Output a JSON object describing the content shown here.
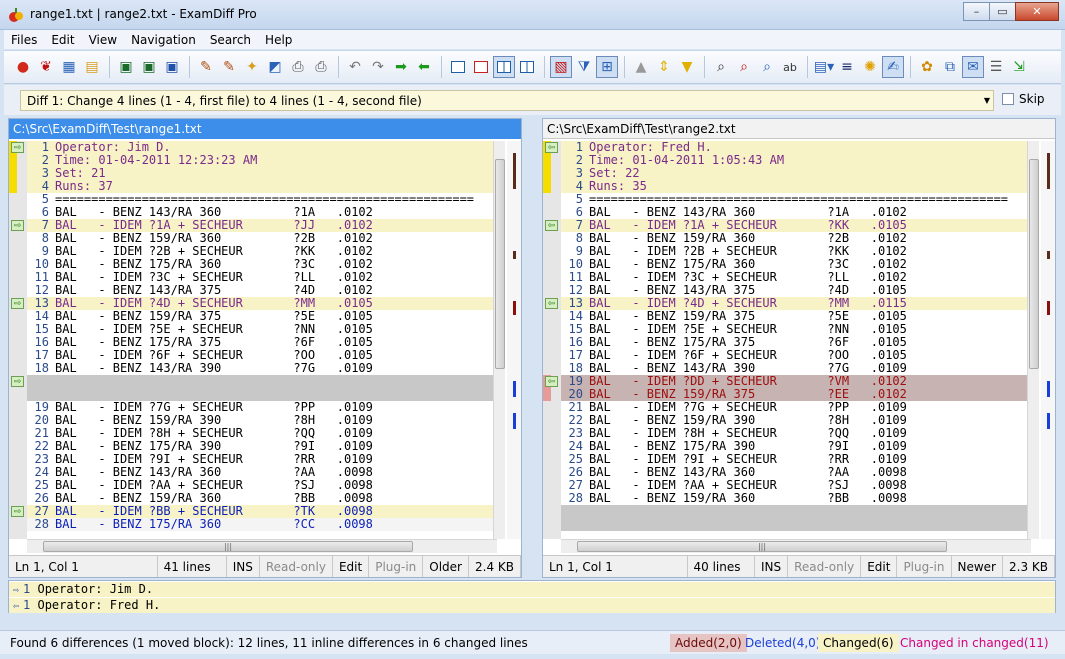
{
  "window": {
    "title": "range1.txt  |  range2.txt - ExamDiff Pro"
  },
  "menu": [
    "Files",
    "Edit",
    "View",
    "Navigation",
    "Search",
    "Help"
  ],
  "diff_selector": {
    "value": "Diff 1: Change 4 lines (1 - 4, first file) to 4 lines (1 - 4, second file)",
    "skip_label": "Skip"
  },
  "left": {
    "path": "C:\\Src\\ExamDiff\\Test\\range1.txt",
    "lines": [
      {
        "n": "1",
        "t": "Operator: Jim D.",
        "k": "chg"
      },
      {
        "n": "2",
        "t": "Time: 01-04-2011 12:23:23 AM",
        "k": "chg"
      },
      {
        "n": "3",
        "t": "Set: 21",
        "k": "chg"
      },
      {
        "n": "4",
        "t": "Runs: 37",
        "k": "chg"
      },
      {
        "n": "5",
        "t": "==========================================================",
        "k": ""
      },
      {
        "n": "6",
        "t": "BAL   - BENZ 143/RA 360          ?1A   .0102",
        "k": ""
      },
      {
        "n": "7",
        "t": "BAL   - IDEM ?1A + SECHEUR       ?JJ   .0102",
        "k": "chg"
      },
      {
        "n": "8",
        "t": "BAL   - BENZ 159/RA 360          ?2B   .0102",
        "k": ""
      },
      {
        "n": "9",
        "t": "BAL   - IDEM ?2B + SECHEUR       ?KK   .0102",
        "k": ""
      },
      {
        "n": "10",
        "t": "BAL   - BENZ 175/RA 360          ?3C   .0102",
        "k": ""
      },
      {
        "n": "11",
        "t": "BAL   - IDEM ?3C + SECHEUR       ?LL   .0102",
        "k": ""
      },
      {
        "n": "12",
        "t": "BAL   - BENZ 143/RA 375          ?4D   .0102",
        "k": ""
      },
      {
        "n": "13",
        "t": "BAL   - IDEM ?4D + SECHEUR       ?MM   .0105",
        "k": "chg"
      },
      {
        "n": "14",
        "t": "BAL   - BENZ 159/RA 375          ?5E   .0105",
        "k": ""
      },
      {
        "n": "15",
        "t": "BAL   - IDEM ?5E + SECHEUR       ?NN   .0105",
        "k": ""
      },
      {
        "n": "16",
        "t": "BAL   - BENZ 175/RA 375          ?6F   .0105",
        "k": ""
      },
      {
        "n": "17",
        "t": "BAL   - IDEM ?6F + SECHEUR       ?OO   .0105",
        "k": ""
      },
      {
        "n": "18",
        "t": "BAL   - BENZ 143/RA 390          ?7G   .0109",
        "k": ""
      },
      {
        "n": "19",
        "t": "BAL   - IDEM ?7G + SECHEUR       ?PP   .0109",
        "k": ""
      },
      {
        "n": "20",
        "t": "BAL   - BENZ 159/RA 390          ?8H   .0109",
        "k": ""
      },
      {
        "n": "21",
        "t": "BAL   - IDEM ?8H + SECHEUR       ?QQ   .0109",
        "k": ""
      },
      {
        "n": "22",
        "t": "BAL   - BENZ 175/RA 390          ?9I   .0109",
        "k": ""
      },
      {
        "n": "23",
        "t": "BAL   - IDEM ?9I + SECHEUR       ?RR   .0109",
        "k": ""
      },
      {
        "n": "24",
        "t": "BAL   - BENZ 143/RA 360          ?AA   .0098",
        "k": ""
      },
      {
        "n": "25",
        "t": "BAL   - IDEM ?AA + SECHEUR       ?SJ   .0098",
        "k": ""
      },
      {
        "n": "26",
        "t": "BAL   - BENZ 159/RA 360          ?BB   .0098",
        "k": ""
      },
      {
        "n": "27",
        "t": "BAL   - IDEM ?BB + SECHEUR       ?TK   .0098",
        "k": "mov"
      },
      {
        "n": "28",
        "t": "BAL   - BENZ 175/RA 360          ?CC   .0098",
        "k": "mov2"
      }
    ],
    "status": {
      "pos": "Ln 1, Col 1",
      "lines": "41 lines",
      "ins": "INS",
      "ro": "Read-only",
      "edit": "Edit",
      "plugin": "Plug-in",
      "age": "Older",
      "size": "2.4 KB"
    }
  },
  "right": {
    "path": "C:\\Src\\ExamDiff\\Test\\range2.txt",
    "lines": [
      {
        "n": "1",
        "t": "Operator: Fred H.",
        "k": "chg"
      },
      {
        "n": "2",
        "t": "Time: 01-04-2011 1:05:43 AM",
        "k": "chg"
      },
      {
        "n": "3",
        "t": "Set: 22",
        "k": "chg"
      },
      {
        "n": "4",
        "t": "Runs: 35",
        "k": "chg"
      },
      {
        "n": "5",
        "t": "==========================================================",
        "k": ""
      },
      {
        "n": "6",
        "t": "BAL   - BENZ 143/RA 360          ?1A   .0102",
        "k": ""
      },
      {
        "n": "7",
        "t": "BAL   - IDEM ?1A + SECHEUR       ?KK   .0105",
        "k": "chg"
      },
      {
        "n": "8",
        "t": "BAL   - BENZ 159/RA 360          ?2B   .0102",
        "k": ""
      },
      {
        "n": "9",
        "t": "BAL   - IDEM ?2B + SECHEUR       ?KK   .0102",
        "k": ""
      },
      {
        "n": "10",
        "t": "BAL   - BENZ 175/RA 360          ?3C   .0102",
        "k": ""
      },
      {
        "n": "11",
        "t": "BAL   - IDEM ?3C + SECHEUR       ?LL   .0102",
        "k": ""
      },
      {
        "n": "12",
        "t": "BAL   - BENZ 143/RA 375          ?4D   .0105",
        "k": ""
      },
      {
        "n": "13",
        "t": "BAL   - IDEM ?4D + SECHEUR       ?MM   .0115",
        "k": "chg"
      },
      {
        "n": "14",
        "t": "BAL   - BENZ 159/RA 375          ?5E   .0105",
        "k": ""
      },
      {
        "n": "15",
        "t": "BAL   - IDEM ?5E + SECHEUR       ?NN   .0105",
        "k": ""
      },
      {
        "n": "16",
        "t": "BAL   - BENZ 175/RA 375          ?6F   .0105",
        "k": ""
      },
      {
        "n": "17",
        "t": "BAL   - IDEM ?6F + SECHEUR       ?OO   .0105",
        "k": ""
      },
      {
        "n": "18",
        "t": "BAL   - BENZ 143/RA 390          ?7G   .0109",
        "k": ""
      },
      {
        "n": "19",
        "t": "BAL   - IDEM ?DD + SECHEUR       ?VM   .0102",
        "k": "add"
      },
      {
        "n": "20",
        "t": "BAL   - BENZ 159/RA 375          ?EE   .0102",
        "k": "add"
      },
      {
        "n": "21",
        "t": "BAL   - IDEM ?7G + SECHEUR       ?PP   .0109",
        "k": ""
      },
      {
        "n": "22",
        "t": "BAL   - BENZ 159/RA 390          ?8H   .0109",
        "k": ""
      },
      {
        "n": "23",
        "t": "BAL   - IDEM ?8H + SECHEUR       ?QQ   .0109",
        "k": ""
      },
      {
        "n": "24",
        "t": "BAL   - BENZ 175/RA 390          ?9I   .0109",
        "k": ""
      },
      {
        "n": "25",
        "t": "BAL   - IDEM ?9I + SECHEUR       ?RR   .0109",
        "k": ""
      },
      {
        "n": "26",
        "t": "BAL   - BENZ 143/RA 360          ?AA   .0098",
        "k": ""
      },
      {
        "n": "27",
        "t": "BAL   - IDEM ?AA + SECHEUR       ?SJ   .0098",
        "k": ""
      },
      {
        "n": "28",
        "t": "BAL   - BENZ 159/RA 360          ?BB   .0098",
        "k": ""
      }
    ],
    "status": {
      "pos": "Ln 1, Col 1",
      "lines": "40 lines",
      "ins": "INS",
      "ro": "Read-only",
      "edit": "Edit",
      "plugin": "Plug-in",
      "age": "Newer",
      "size": "2.3 KB"
    }
  },
  "compare": {
    "line1": "Operator: Jim D.",
    "line2": "Operator: Fred H.",
    "n1": "1",
    "n2": "1"
  },
  "statusbar": {
    "message": "Found 6 differences (1 moved block): 12 lines, 11 inline differences in 6 changed lines",
    "added": "Added(2,0)",
    "deleted": "Deleted(4,0)",
    "changed": "Changed(6)",
    "changed_in_changed": "Changed in changed(11)"
  },
  "colors": {
    "added_bg": "#e6c4c4",
    "deleted_fg": "#1a3fd6",
    "changed_bg": "#f8f3c6",
    "cic_fg": "#d6007a"
  }
}
